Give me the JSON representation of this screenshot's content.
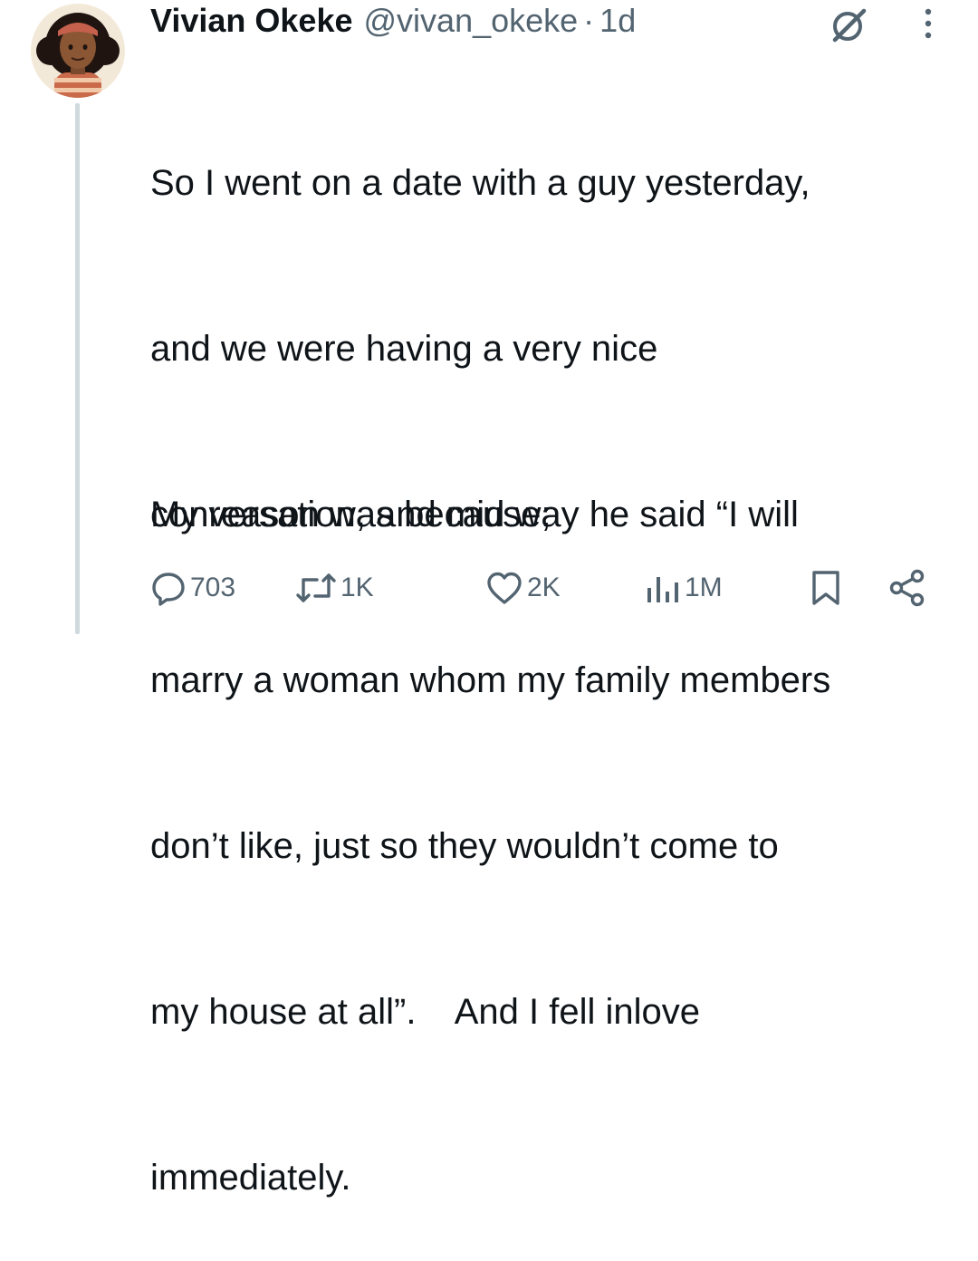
{
  "tweet": {
    "author_name": "Vivian Okeke",
    "handle": "@vivan_okeke",
    "separator": "·",
    "time": "1d",
    "text_lines": [
      "So I went on a date with a guy yesterday,",
      "and we were having a very nice",
      "conversation, and mid way he said “I will",
      "marry a woman whom my family members",
      "don’t like, just so they wouldn’t come to",
      "my house at all”.    And I fell inlove",
      "immediately."
    ],
    "paragraph_2": "My reason was because;",
    "avatar_icon": "profile-avatar-illustration",
    "header_icons": [
      "grok-icon",
      "more-vertical-icon"
    ]
  },
  "actions": {
    "reply": {
      "icon": "reply-icon",
      "count": "703"
    },
    "retweet": {
      "icon": "retweet-icon",
      "count": "1K"
    },
    "like": {
      "icon": "heart-icon",
      "count": "2K"
    },
    "views": {
      "icon": "views-icon",
      "count": "1M"
    },
    "bookmark": {
      "icon": "bookmark-icon"
    },
    "share": {
      "icon": "share-icon"
    }
  },
  "colors": {
    "text": "#0f1419",
    "secondary": "#536471",
    "thread_line": "#cfd9de",
    "background": "#ffffff"
  }
}
